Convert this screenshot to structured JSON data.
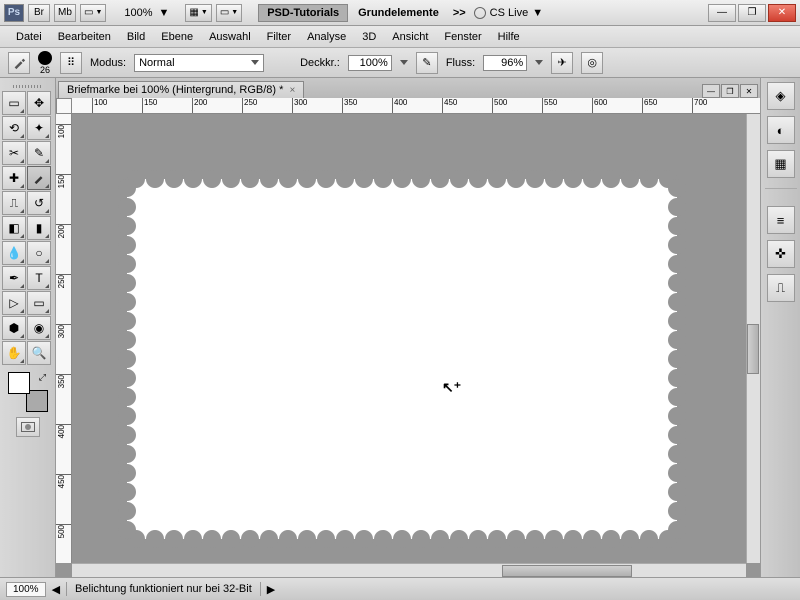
{
  "app": {
    "logo": "Ps"
  },
  "titlebar": {
    "br": "Br",
    "mb": "Mb",
    "zoom": "100%",
    "workspace1": "PSD-Tutorials",
    "workspace2": "Grundelemente",
    "chev": ">>",
    "cslive": "CS Live",
    "window": {
      "min": "—",
      "max": "❐",
      "close": "✕"
    }
  },
  "menu": [
    "Datei",
    "Bearbeiten",
    "Bild",
    "Ebene",
    "Auswahl",
    "Filter",
    "Analyse",
    "3D",
    "Ansicht",
    "Fenster",
    "Hilfe"
  ],
  "options": {
    "brush_size": "26",
    "mode_label": "Modus:",
    "mode_value": "Normal",
    "opacity_label": "Deckkr.:",
    "opacity_value": "100%",
    "flow_label": "Fluss:",
    "flow_value": "96%"
  },
  "doc": {
    "tab_title": "Briefmarke bei 100% (Hintergrund, RGB/8) *"
  },
  "ruler_h": [
    100,
    150,
    200,
    250,
    300,
    350,
    400,
    450,
    500,
    550,
    600,
    650,
    700
  ],
  "ruler_v": [
    100,
    150,
    200,
    250,
    300,
    350,
    400,
    450,
    500
  ],
  "status": {
    "zoom": "100%",
    "msg": "Belichtung funktioniert nur bei 32-Bit"
  },
  "panels": [
    "layers",
    "color",
    "swatches",
    "adjustments",
    "masks",
    "brush"
  ]
}
